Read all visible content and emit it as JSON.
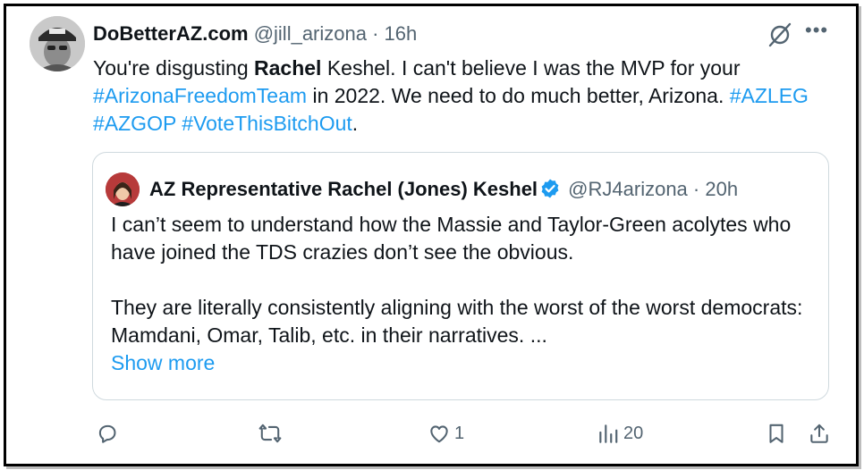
{
  "tweet": {
    "display_name": "DoBetterAZ.com",
    "handle": "@jill_arizona",
    "separator": " · ",
    "time": "16h",
    "more_label": "•••",
    "text": {
      "p1": "You're disgusting ",
      "bold": "Rachel",
      "p2": " Keshel. I can't believe I was the MVP for your ",
      "tag1": "#ArizonaFreedomTeam",
      "p3": " in 2022. We need to do much better, Arizona. ",
      "tag2": "#AZLEG",
      "sp1": " ",
      "tag3": "#AZGOP",
      "sp2": " ",
      "tag4": "#VoteThisBitchOut",
      "end": "."
    }
  },
  "quote": {
    "display_name": "AZ Representative Rachel (Jones) Keshel",
    "handle": "@RJ4arizona",
    "separator": " · ",
    "time": "20h",
    "paragraph1": "I can’t seem to understand how the Massie and Taylor-Green acolytes who have joined the TDS crazies don’t see the obvious.",
    "paragraph2": "They are literally consistently aligning with the worst of the worst democrats: Mamdani, Omar, Talib, etc. in their narratives. ...",
    "show_more": "Show more"
  },
  "actions": {
    "reply_count": "",
    "repost_count": "",
    "like_count": "1",
    "views_count": "20"
  },
  "colors": {
    "link": "#1d9bf0",
    "muted": "#536471",
    "text": "#0f1419",
    "border": "#cfd9de"
  },
  "icons": [
    "grok-icon",
    "more-icon",
    "verified-icon",
    "reply-icon",
    "repost-icon",
    "like-icon",
    "views-icon",
    "bookmark-icon",
    "share-icon"
  ]
}
